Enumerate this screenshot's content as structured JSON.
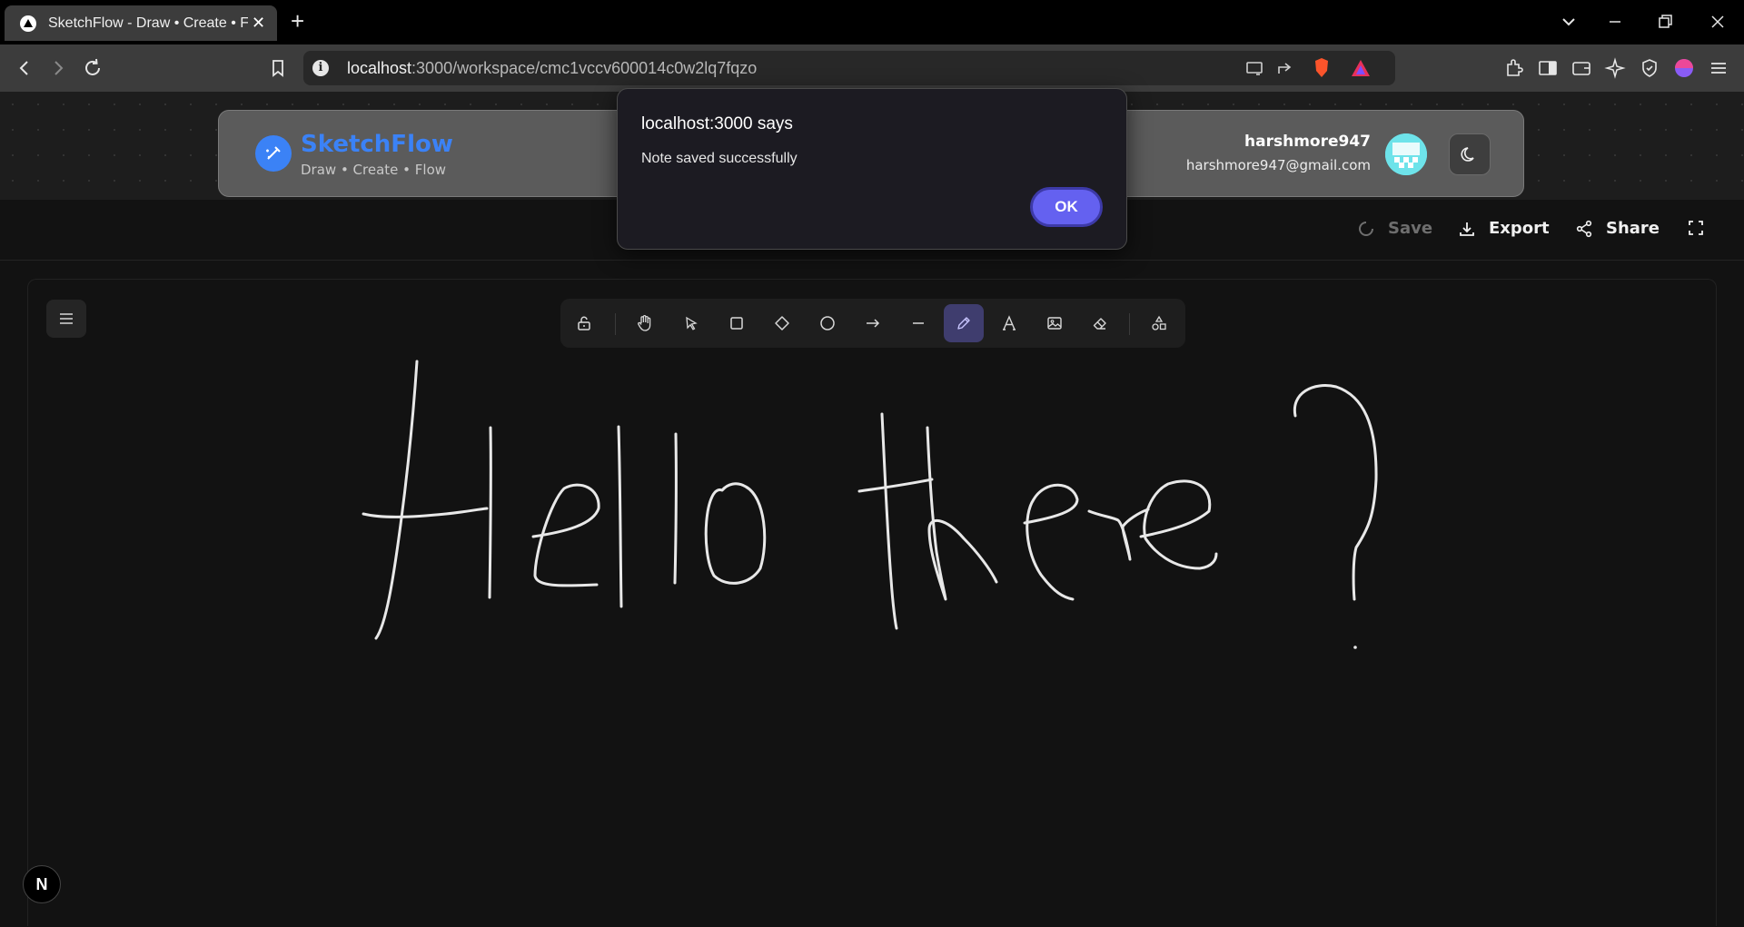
{
  "browser": {
    "tab_title": "SketchFlow - Draw • Create • Flow",
    "url_host": "localhost",
    "url_rest": ":3000/workspace/cmc1vccv600014c0w2lq7fqzo"
  },
  "app": {
    "brand_name": "SketchFlow",
    "brand_tagline": "Draw • Create • Flow",
    "user_name": "harshmore947",
    "user_email": "harshmore947@gmail.com",
    "accent_color": "#3b82f6"
  },
  "actions": {
    "save_label": "Save",
    "export_label": "Export",
    "share_label": "Share"
  },
  "toolbar": {
    "tools": [
      "lock",
      "hand",
      "select",
      "rectangle",
      "diamond",
      "ellipse",
      "arrow",
      "line",
      "pencil",
      "text",
      "image",
      "eraser",
      "shapes"
    ],
    "active_tool": "pencil"
  },
  "dialog": {
    "title": "localhost:3000 says",
    "message": "Note saved successfully",
    "ok_label": "OK"
  },
  "misc": {
    "next_badge": "N"
  }
}
